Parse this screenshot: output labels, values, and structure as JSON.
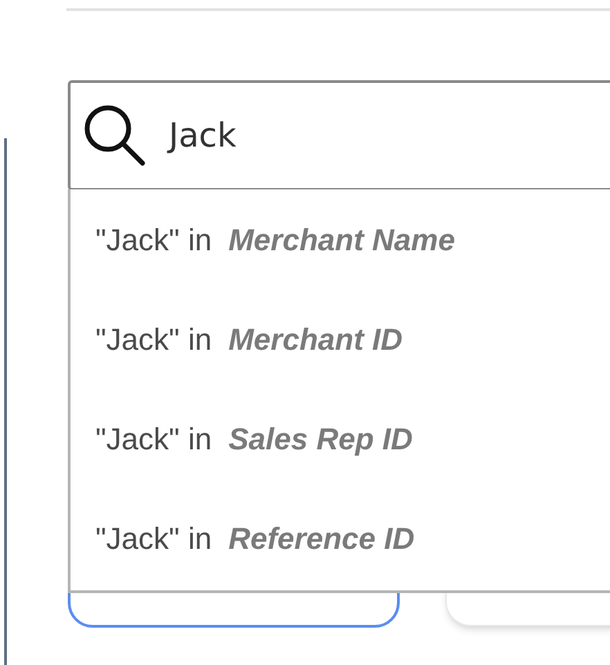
{
  "search": {
    "value": "Jack"
  },
  "suggestions": [
    {
      "prefix": "\"Jack\" in",
      "field": "Merchant Name"
    },
    {
      "prefix": "\"Jack\" in",
      "field": "Merchant ID"
    },
    {
      "prefix": "\"Jack\" in",
      "field": "Sales Rep ID"
    },
    {
      "prefix": "\"Jack\" in",
      "field": "Reference ID"
    }
  ]
}
